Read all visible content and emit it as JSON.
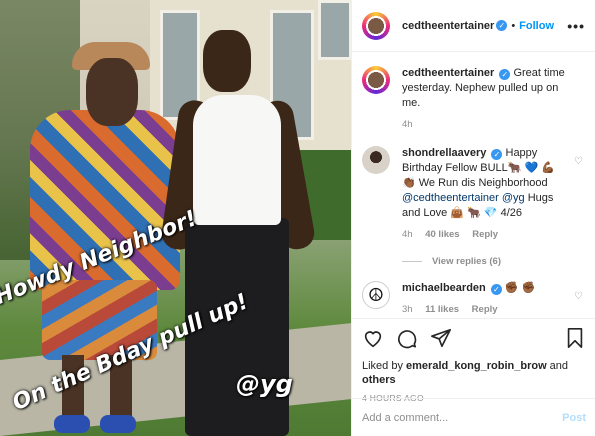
{
  "photo": {
    "stickers": {
      "howdy": "Howdy Neighbor!",
      "bday": "On the Bday pull up!",
      "tag": "@yg"
    }
  },
  "header": {
    "username": "cedtheentertainer",
    "dot": "•",
    "follow_label": "Follow",
    "more_label": "•••"
  },
  "caption": {
    "username": "cedtheentertainer",
    "text": "Great time yesterday. Nephew pulled up on me.",
    "time": "4h"
  },
  "comments": [
    {
      "username": "shondrellaavery",
      "text_pre": "Happy Birthday Fellow BULL🐂 💙 💪🏾 👏🏾 We Run dis Neighborhood ",
      "mention1": "@cedtheentertainer",
      "mention2": "@yg",
      "text_post": " Hugs and Love 👜 🐂 💎 4/26",
      "time": "4h",
      "likes": "40 likes",
      "reply": "Reply",
      "view_replies": "View replies (6)"
    },
    {
      "username": "michaelbearden",
      "text": "✊🏾 ✊🏾",
      "time": "3h",
      "likes": "11 likes",
      "reply": "Reply"
    }
  ],
  "actions": {
    "liked_by_prefix": "Liked by ",
    "liked_by_user": "emerald_kong_robin_brow",
    "liked_by_and": " and ",
    "liked_by_others": "others",
    "timestamp": "4 HOURS AGO"
  },
  "add_comment": {
    "placeholder": "Add a comment...",
    "post_label": "Post"
  },
  "icons": {
    "verified": "✓",
    "heart_small": "♡",
    "peace": "☮"
  },
  "colors": {
    "link_blue": "#0095f6",
    "verified_blue": "#3897f0",
    "post_disabled": "#b2dffc",
    "muted": "#8e8e8e"
  }
}
